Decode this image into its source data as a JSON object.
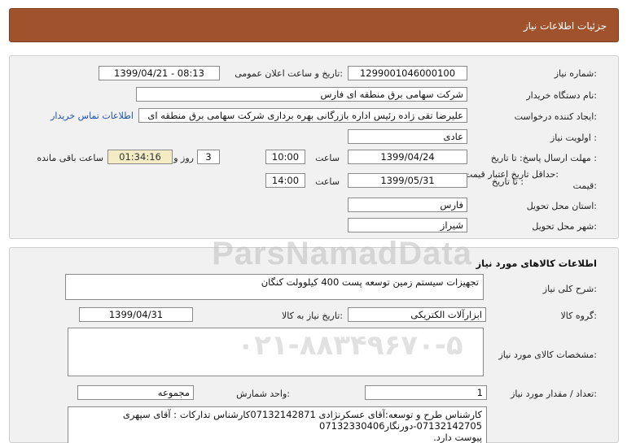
{
  "header": {
    "title": "جزئیات اطلاعات نیاز"
  },
  "need": {
    "number_label": "شماره نیاز:",
    "number_value": "1299001046000100",
    "announce_label": "تاریخ و ساعت اعلان عمومی:",
    "announce_value": "1399/04/21 - 08:13",
    "buyer_label": "نام دستگاه خریدار:",
    "buyer_value": "شرکت سهامی برق منطقه ای فارس",
    "creator_label": "ایجاد کننده درخواست:",
    "creator_value": "علیرضا  تقی زاده رئیس اداره بازرگانی بهره برداری شرکت سهامی برق منطقه ای",
    "contact_link": "اطلاعات تماس خریدار",
    "priority_label": "اولویت نیاز :",
    "priority_value": "عادی",
    "deadline_label": "مهلت ارسال پاسخ: تا تاریخ :",
    "deadline_date": "1399/04/24",
    "time_label": "ساعت",
    "deadline_time": "10:00",
    "days_value": "3",
    "days_label": "روز و",
    "remaining_value": "01:34:16",
    "remaining_label": "ساعت باقی مانده",
    "validity_label": "حداقل تاریخ اعتبار قیمت:",
    "validity_sub_label": "تا تاریخ :",
    "validity_date": "1399/05/31",
    "validity_time_label": "ساعت",
    "validity_time": "14:00",
    "province_label": "استان محل تحویل:",
    "province_value": "فارس",
    "city_label": "شهر محل تحویل:",
    "city_value": "شیراز"
  },
  "goods": {
    "section_title": "اطلاعات کالاهای مورد نیاز",
    "desc_label": "شرح کلی نیاز:",
    "desc_value": "تجهیزات سیستم زمین توسعه پست 400 کیلوولت کنگان",
    "group_label": "گروه کالا:",
    "group_value": "ابزارآلات الکتریکی",
    "need_date_label": "تاریخ نیاز به کالا:",
    "need_date_value": "1399/04/31",
    "specs_label": "مشخصات کالای مورد نیاز:",
    "specs_value": "",
    "qty_label": "تعداد / مقدار مورد نیاز:",
    "qty_value": "1",
    "unit_label": "واحد شمارش:",
    "unit_value": "مجموعه",
    "notes_line1": "کارشناس طرح و توسعه:آقای عسکرنژادی 07132142871کارشناس تدارکات : آقای سپهری",
    "notes_line2": "07132142705-دورنگار07132330406",
    "notes_line3": "پیوست دارد."
  },
  "watermark": {
    "text1": "ParsNamadData",
    "text2": "۰۲۱-۸۸۳۴۹۶۷۰-۵"
  }
}
